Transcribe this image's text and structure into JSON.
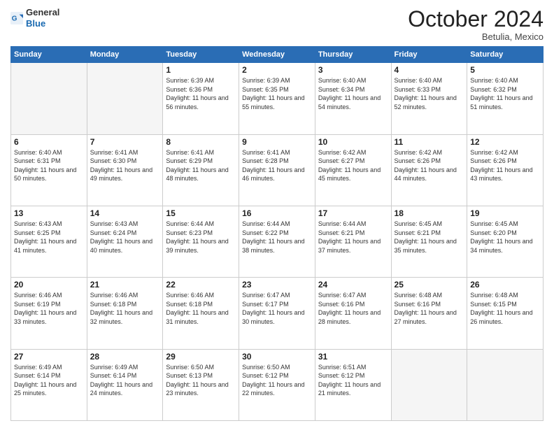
{
  "header": {
    "logo_general": "General",
    "logo_blue": "Blue",
    "month": "October 2024",
    "location": "Betulia, Mexico"
  },
  "weekdays": [
    "Sunday",
    "Monday",
    "Tuesday",
    "Wednesday",
    "Thursday",
    "Friday",
    "Saturday"
  ],
  "weeks": [
    [
      {
        "day": "",
        "info": ""
      },
      {
        "day": "",
        "info": ""
      },
      {
        "day": "1",
        "info": "Sunrise: 6:39 AM\nSunset: 6:36 PM\nDaylight: 11 hours and 56 minutes."
      },
      {
        "day": "2",
        "info": "Sunrise: 6:39 AM\nSunset: 6:35 PM\nDaylight: 11 hours and 55 minutes."
      },
      {
        "day": "3",
        "info": "Sunrise: 6:40 AM\nSunset: 6:34 PM\nDaylight: 11 hours and 54 minutes."
      },
      {
        "day": "4",
        "info": "Sunrise: 6:40 AM\nSunset: 6:33 PM\nDaylight: 11 hours and 52 minutes."
      },
      {
        "day": "5",
        "info": "Sunrise: 6:40 AM\nSunset: 6:32 PM\nDaylight: 11 hours and 51 minutes."
      }
    ],
    [
      {
        "day": "6",
        "info": "Sunrise: 6:40 AM\nSunset: 6:31 PM\nDaylight: 11 hours and 50 minutes."
      },
      {
        "day": "7",
        "info": "Sunrise: 6:41 AM\nSunset: 6:30 PM\nDaylight: 11 hours and 49 minutes."
      },
      {
        "day": "8",
        "info": "Sunrise: 6:41 AM\nSunset: 6:29 PM\nDaylight: 11 hours and 48 minutes."
      },
      {
        "day": "9",
        "info": "Sunrise: 6:41 AM\nSunset: 6:28 PM\nDaylight: 11 hours and 46 minutes."
      },
      {
        "day": "10",
        "info": "Sunrise: 6:42 AM\nSunset: 6:27 PM\nDaylight: 11 hours and 45 minutes."
      },
      {
        "day": "11",
        "info": "Sunrise: 6:42 AM\nSunset: 6:26 PM\nDaylight: 11 hours and 44 minutes."
      },
      {
        "day": "12",
        "info": "Sunrise: 6:42 AM\nSunset: 6:26 PM\nDaylight: 11 hours and 43 minutes."
      }
    ],
    [
      {
        "day": "13",
        "info": "Sunrise: 6:43 AM\nSunset: 6:25 PM\nDaylight: 11 hours and 41 minutes."
      },
      {
        "day": "14",
        "info": "Sunrise: 6:43 AM\nSunset: 6:24 PM\nDaylight: 11 hours and 40 minutes."
      },
      {
        "day": "15",
        "info": "Sunrise: 6:44 AM\nSunset: 6:23 PM\nDaylight: 11 hours and 39 minutes."
      },
      {
        "day": "16",
        "info": "Sunrise: 6:44 AM\nSunset: 6:22 PM\nDaylight: 11 hours and 38 minutes."
      },
      {
        "day": "17",
        "info": "Sunrise: 6:44 AM\nSunset: 6:21 PM\nDaylight: 11 hours and 37 minutes."
      },
      {
        "day": "18",
        "info": "Sunrise: 6:45 AM\nSunset: 6:21 PM\nDaylight: 11 hours and 35 minutes."
      },
      {
        "day": "19",
        "info": "Sunrise: 6:45 AM\nSunset: 6:20 PM\nDaylight: 11 hours and 34 minutes."
      }
    ],
    [
      {
        "day": "20",
        "info": "Sunrise: 6:46 AM\nSunset: 6:19 PM\nDaylight: 11 hours and 33 minutes."
      },
      {
        "day": "21",
        "info": "Sunrise: 6:46 AM\nSunset: 6:18 PM\nDaylight: 11 hours and 32 minutes."
      },
      {
        "day": "22",
        "info": "Sunrise: 6:46 AM\nSunset: 6:18 PM\nDaylight: 11 hours and 31 minutes."
      },
      {
        "day": "23",
        "info": "Sunrise: 6:47 AM\nSunset: 6:17 PM\nDaylight: 11 hours and 30 minutes."
      },
      {
        "day": "24",
        "info": "Sunrise: 6:47 AM\nSunset: 6:16 PM\nDaylight: 11 hours and 28 minutes."
      },
      {
        "day": "25",
        "info": "Sunrise: 6:48 AM\nSunset: 6:16 PM\nDaylight: 11 hours and 27 minutes."
      },
      {
        "day": "26",
        "info": "Sunrise: 6:48 AM\nSunset: 6:15 PM\nDaylight: 11 hours and 26 minutes."
      }
    ],
    [
      {
        "day": "27",
        "info": "Sunrise: 6:49 AM\nSunset: 6:14 PM\nDaylight: 11 hours and 25 minutes."
      },
      {
        "day": "28",
        "info": "Sunrise: 6:49 AM\nSunset: 6:14 PM\nDaylight: 11 hours and 24 minutes."
      },
      {
        "day": "29",
        "info": "Sunrise: 6:50 AM\nSunset: 6:13 PM\nDaylight: 11 hours and 23 minutes."
      },
      {
        "day": "30",
        "info": "Sunrise: 6:50 AM\nSunset: 6:12 PM\nDaylight: 11 hours and 22 minutes."
      },
      {
        "day": "31",
        "info": "Sunrise: 6:51 AM\nSunset: 6:12 PM\nDaylight: 11 hours and 21 minutes."
      },
      {
        "day": "",
        "info": ""
      },
      {
        "day": "",
        "info": ""
      }
    ]
  ]
}
